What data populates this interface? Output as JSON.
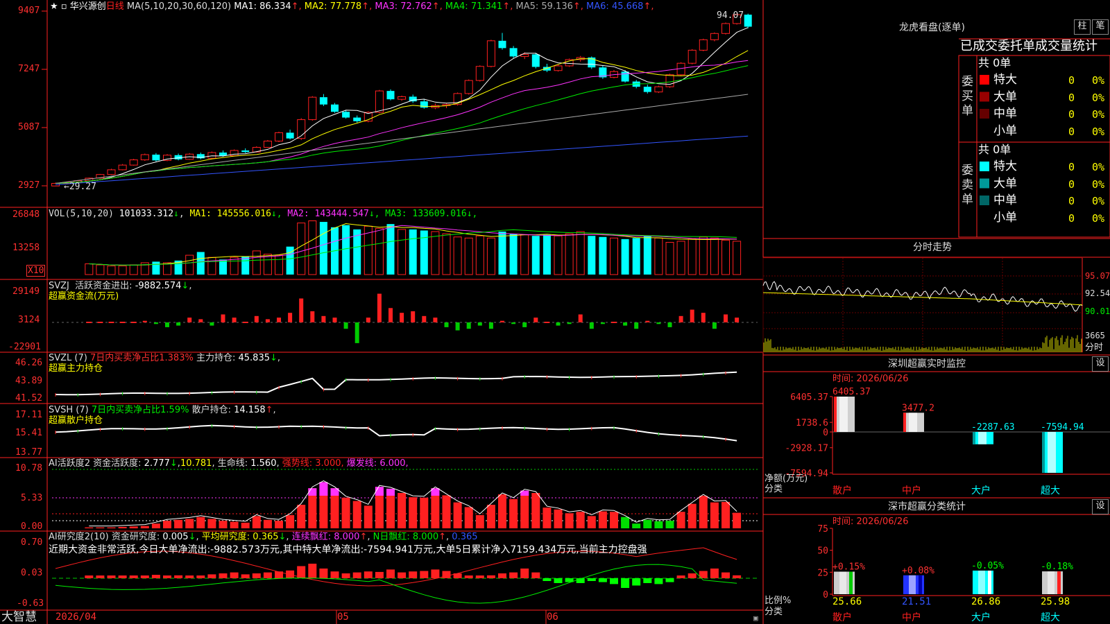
{
  "stock": {
    "name": "华兴源创",
    "period": "日线",
    "ma_label": "MA(5,10,20,30,60,120)",
    "ma": [
      {
        "name": "MA1",
        "value": "86.334",
        "color": "#ffffff"
      },
      {
        "name": "MA2",
        "value": "77.778",
        "color": "#ffff00"
      },
      {
        "name": "MA3",
        "value": "72.762",
        "color": "#ff33ff"
      },
      {
        "name": "MA4",
        "value": "71.341",
        "color": "#00ee00"
      },
      {
        "name": "MA5",
        "value": "59.136",
        "color": "#aaaaaa"
      },
      {
        "name": "MA6",
        "value": "45.668",
        "color": "#3355ff"
      }
    ],
    "up_arrow": "↑",
    "down_arrow": "↓",
    "high_label": "94.07",
    "low_label": "←29.27"
  },
  "price_axis": [
    "9407",
    "7247",
    "5087",
    "2927"
  ],
  "vol": {
    "axis": [
      "26848",
      "13258"
    ],
    "unit": "X10",
    "title": "VOL(5,10,20)",
    "value": "101033.312",
    "ma": [
      {
        "name": "MA1",
        "value": "145556.016",
        "color": "#ffff00"
      },
      {
        "name": "MA2",
        "value": "143444.547",
        "color": "#ff33ff"
      },
      {
        "name": "MA3",
        "value": "133609.016",
        "color": "#00ee00"
      }
    ],
    "values": [
      10,
      9,
      8,
      8,
      9,
      11,
      12,
      11,
      13,
      18,
      21,
      16,
      14,
      16,
      17,
      22,
      19,
      18,
      26,
      48,
      50,
      49,
      44,
      46,
      42,
      45,
      43,
      47,
      42,
      42,
      41,
      40,
      38,
      35,
      34,
      36,
      34,
      40,
      38,
      37,
      36,
      37,
      36,
      38,
      40,
      36,
      35,
      34,
      33,
      34,
      36,
      34,
      30,
      31,
      33,
      35,
      34,
      32,
      31
    ]
  },
  "svzj": {
    "axis": [
      "29149",
      "3124",
      "-22901"
    ],
    "title": "SVZJ",
    "label": "活跃资金进出:",
    "value": "-9882.574",
    "sub": "超赢资金流(万元)",
    "values": [
      0,
      0,
      0,
      0,
      0,
      0.1,
      -0.1,
      -0.3,
      -0.2,
      0.3,
      0.2,
      -0.2,
      0.5,
      0.3,
      0,
      0.4,
      0.2,
      0.3,
      0.6,
      1.5,
      0.7,
      0.4,
      0.3,
      -0.4,
      -1.3,
      0.3,
      1.8,
      0.9,
      0.6,
      0.7,
      0.4,
      0.3,
      -0.3,
      -0.5,
      -0.4,
      -0.2,
      -0.4,
      0.1,
      -0.1,
      -0.3,
      0.3,
      0,
      -0.2,
      -0.1,
      0.5,
      -0.4,
      -0.1,
      0,
      -0.2,
      -0.4,
      0.1,
      -0.1,
      -0.3,
      0.4,
      0.8,
      0.6,
      -0.4,
      0.5,
      0.3
    ]
  },
  "svzl": {
    "axis": [
      "46.26",
      "43.89",
      "41.52"
    ],
    "title": "SVZL (7)",
    "desc": "7日内买卖净占比1.383%",
    "label": "主力持仓:",
    "value": "45.835",
    "sub": "超赢主力持仓"
  },
  "svsh": {
    "axis": [
      "17.11",
      "15.41",
      "13.77"
    ],
    "title": "SVSH (7)",
    "desc": "7日内买卖净占比1.59%",
    "label": "散户持仓:",
    "value": "14.158",
    "sub": "超赢散户持仓"
  },
  "ai1": {
    "axis": [
      "10.78",
      "5.33",
      "0.00"
    ],
    "title": "AI活跃度2",
    "label": "资金活跃度:",
    "value": "2.777",
    "value2": "10.781",
    "life_label": "生命线:",
    "life": "1.560",
    "strong_label": "强势线:",
    "strong": "3.000",
    "burst_label": "爆发线:",
    "burst": "6.000",
    "values": [
      0.2,
      0.2,
      0.2,
      0.3,
      0.4,
      0.5,
      1.0,
      1.6,
      1.8,
      2.0,
      2.4,
      2.0,
      1.6,
      1.4,
      1.2,
      2.6,
      1.8,
      1.6,
      2.8,
      5.0,
      8.5,
      9.8,
      8.5,
      6.5,
      5.8,
      4.8,
      8.8,
      8.4,
      7.5,
      6.6,
      6.5,
      8.5,
      7.0,
      5.5,
      4.5,
      2.8,
      5.0,
      7.2,
      6.2,
      8.0,
      7.5,
      4.4,
      4.0,
      3.2,
      3.5,
      2.6,
      3.6,
      3.5,
      2.4,
      1.0,
      1.8,
      1.5,
      1.6,
      3.5,
      5.2,
      6.9,
      5.5,
      5.6,
      3.3
    ]
  },
  "ai2": {
    "axis": [
      "0.70",
      "0.03",
      "-0.63"
    ],
    "title": "AI研究度2(10)",
    "label": "资金研究度:",
    "value": "0.005",
    "avg_label": "平均研究度:",
    "avg": "0.365",
    "cont_label": "连续飘红:",
    "cont": "8.000",
    "nred_label": "N日飘红:",
    "nred": "8.000",
    "tail": "0.365",
    "comment": "近期大资金非常活跃,今日大单净流出:-9882.573万元,其中特大单净流出:-7594.941万元,大单5日累计净入7159.434万元,当前主力控盘强",
    "values": [
      0.03,
      0.02,
      0.05,
      0.04,
      0.03,
      0.05,
      0.07,
      0.05,
      0.06,
      0.05,
      0.04,
      0.08,
      0.1,
      0.12,
      0.08,
      0.1,
      0.12,
      0.14,
      0.16,
      0.25,
      0.3,
      0.2,
      0.14,
      0.1,
      0.12,
      0.14,
      0.13,
      0.18,
      0.12,
      0.14,
      0.15,
      0.18,
      0.15,
      0.1,
      0.05,
      0.02,
      0.06,
      0.1,
      0.12,
      0.2,
      0.12,
      -0.05,
      -0.1,
      -0.08,
      -0.1,
      -0.05,
      -0.08,
      -0.12,
      -0.2,
      -0.15,
      -0.1,
      -0.12,
      -0.08,
      0.05,
      0.1,
      0.15,
      0.2,
      0.12,
      0.06
    ]
  },
  "xaxis": {
    "labels": [
      "2026/04",
      "05",
      "06"
    ]
  },
  "footer": {
    "brand": "大智慧"
  },
  "dragon": {
    "title": "龙虎看盘(逐单)",
    "btn1": "柱",
    "btn2": "笔",
    "headers": [
      "已成交",
      "委托单",
      "成交量",
      "统计"
    ],
    "buy_side": "委买单",
    "sell_side": "委卖单",
    "buy_total": "共 0单",
    "sell_total": "共 0单",
    "buy_rows": [
      {
        "name": "特大",
        "count": "0",
        "pct": "0%",
        "color": "#ff0000"
      },
      {
        "name": "大单",
        "count": "0",
        "pct": "0%",
        "color": "#990000"
      },
      {
        "name": "中单",
        "count": "0",
        "pct": "0%",
        "color": "#660000"
      },
      {
        "name": "小单",
        "count": "0",
        "pct": "0%",
        "color": ""
      }
    ],
    "sell_rows": [
      {
        "name": "特大",
        "count": "0",
        "pct": "0%",
        "color": "#00ffff"
      },
      {
        "name": "大单",
        "count": "0",
        "pct": "0%",
        "color": "#009999"
      },
      {
        "name": "中单",
        "count": "0",
        "pct": "0%",
        "color": "#006666"
      },
      {
        "name": "小单",
        "count": "0",
        "pct": "0%",
        "color": ""
      }
    ]
  },
  "intraday": {
    "title": "分时走势",
    "axis": [
      "95.07",
      "92.54",
      "90.01"
    ],
    "vol": "3665",
    "label": "分时"
  },
  "sz_monitor": {
    "title": "深圳超赢实时监控",
    "btn": "设",
    "time_label": "时间:",
    "time": "2026/06/26",
    "axis": [
      "6405.37",
      "1738.6",
      "0",
      "-2928.17",
      "-7594.94"
    ],
    "ylabel": "净额(万元)",
    "xlabel": "分类",
    "bars": [
      {
        "name": "散户",
        "value": 6405.37,
        "label": "6405.37",
        "color": "#cccccc",
        "cat_color": "#ff2020"
      },
      {
        "name": "中户",
        "value": 3477.2,
        "label": "3477.2",
        "color": "#cccccc",
        "cat_color": "#ff2020"
      },
      {
        "name": "大户",
        "value": -2287.63,
        "label": "-2287.63",
        "color": "#00ffff",
        "cat_color": "#00ffff"
      },
      {
        "name": "超大",
        "value": -7594.94,
        "label": "-7594.94",
        "color": "#00ffff",
        "cat_color": "#00ffff"
      }
    ]
  },
  "sc_stats": {
    "title": "深市超赢分类统计",
    "btn": "设",
    "time_label": "时间:",
    "time": "2026/06/26",
    "axis": [
      "75",
      "50",
      "25",
      "0"
    ],
    "ylabel": "比例%",
    "xlabel": "分类",
    "bars": [
      {
        "name": "散户",
        "pct": 25.66,
        "pct_label": "25.66",
        "delta": "+0.15%",
        "color": "#cccccc",
        "stripe": "#00cc00",
        "delta_color": "#ff3333",
        "cat_color": "#ff2020"
      },
      {
        "name": "中户",
        "pct": 21.51,
        "pct_label": "21.51",
        "delta": "+0.08%",
        "color": "#2233ff",
        "stripe": "#0000aa",
        "delta_color": "#ff3333",
        "cat_color": "#ff2020"
      },
      {
        "name": "大户",
        "pct": 26.86,
        "pct_label": "26.86",
        "delta": "-0.05%",
        "color": "#00ffff",
        "stripe": "#ffffff",
        "delta_color": "#00ff00",
        "cat_color": "#00ffff"
      },
      {
        "name": "超大",
        "pct": 25.98,
        "pct_label": "25.98",
        "delta": "-0.18%",
        "color": "#cccccc",
        "stripe": "#ff2020",
        "delta_color": "#00ff00",
        "cat_color": "#00ffff"
      }
    ]
  },
  "candles": [
    [
      28.0,
      29.3,
      27.9,
      29.0
    ],
    [
      29.0,
      29.6,
      28.6,
      29.4
    ],
    [
      29.4,
      30.2,
      29.2,
      30.0
    ],
    [
      30.0,
      31.2,
      29.8,
      31.0
    ],
    [
      31.0,
      32.6,
      30.8,
      32.4
    ],
    [
      32.4,
      34.6,
      32.2,
      34.2
    ],
    [
      34.2,
      36.4,
      34.0,
      36.0
    ],
    [
      36.0,
      38.4,
      35.8,
      38.0
    ],
    [
      38.0,
      40.4,
      37.6,
      40.0
    ],
    [
      40.0,
      40.6,
      37.4,
      37.8
    ],
    [
      37.8,
      40.2,
      37.5,
      39.8
    ],
    [
      39.8,
      40.4,
      37.8,
      38.2
    ],
    [
      38.2,
      40.6,
      38.0,
      40.2
    ],
    [
      40.2,
      40.8,
      38.2,
      38.6
    ],
    [
      38.6,
      41.2,
      38.4,
      40.8
    ],
    [
      40.8,
      41.6,
      39.2,
      39.6
    ],
    [
      39.6,
      42.0,
      39.4,
      41.6
    ],
    [
      41.6,
      42.4,
      40.6,
      41.0
    ],
    [
      41.0,
      43.2,
      40.8,
      42.8
    ],
    [
      42.8,
      45.6,
      42.6,
      45.2
    ],
    [
      45.2,
      48.8,
      44.8,
      48.4
    ],
    [
      48.4,
      49.6,
      45.8,
      46.2
    ],
    [
      46.2,
      54.0,
      45.6,
      53.4
    ],
    [
      53.4,
      62.4,
      53.0,
      62.0
    ],
    [
      62.0,
      63.2,
      58.6,
      59.2
    ],
    [
      59.2,
      59.8,
      56.0,
      56.4
    ],
    [
      56.4,
      57.0,
      53.8,
      54.2
    ],
    [
      54.2,
      55.0,
      52.2,
      52.8
    ],
    [
      52.8,
      56.6,
      52.4,
      56.2
    ],
    [
      56.2,
      64.8,
      55.8,
      64.4
    ],
    [
      64.4,
      65.0,
      60.8,
      61.2
    ],
    [
      61.2,
      62.6,
      60.6,
      62.2
    ],
    [
      62.2,
      63.0,
      59.8,
      60.4
    ],
    [
      60.4,
      61.2,
      57.6,
      58.0
    ],
    [
      58.0,
      59.6,
      57.4,
      58.8
    ],
    [
      58.8,
      59.6,
      57.8,
      59.2
    ],
    [
      59.2,
      63.8,
      58.8,
      63.4
    ],
    [
      63.4,
      68.8,
      63.0,
      68.4
    ],
    [
      68.4,
      74.2,
      68.0,
      73.8
    ],
    [
      73.8,
      84.0,
      73.4,
      83.6
    ],
    [
      83.6,
      86.6,
      80.2,
      80.8
    ],
    [
      80.8,
      81.6,
      77.0,
      77.6
    ],
    [
      77.6,
      79.2,
      76.6,
      78.4
    ],
    [
      78.4,
      79.0,
      73.0,
      73.6
    ],
    [
      73.6,
      74.8,
      71.6,
      72.2
    ],
    [
      72.2,
      74.6,
      71.8,
      74.0
    ],
    [
      74.0,
      76.8,
      73.6,
      76.4
    ],
    [
      76.4,
      77.8,
      75.6,
      77.2
    ],
    [
      77.2,
      77.6,
      72.8,
      73.4
    ],
    [
      73.4,
      74.0,
      69.0,
      69.6
    ],
    [
      69.6,
      72.4,
      69.2,
      71.8
    ],
    [
      71.8,
      72.4,
      67.6,
      68.0
    ],
    [
      68.0,
      68.6,
      65.4,
      66.0
    ],
    [
      66.0,
      66.8,
      63.4,
      64.0
    ],
    [
      64.0,
      66.4,
      63.6,
      66.0
    ],
    [
      66.0,
      71.0,
      65.6,
      70.6
    ],
    [
      70.6,
      75.4,
      70.2,
      75.0
    ],
    [
      75.0,
      80.4,
      74.6,
      80.0
    ],
    [
      80.0,
      84.4,
      79.6,
      84.0
    ],
    [
      84.0,
      86.8,
      83.4,
      86.4
    ],
    [
      86.4,
      90.6,
      86.0,
      90.2
    ],
    [
      90.2,
      94.07,
      89.8,
      93.6
    ],
    [
      93.6,
      94.0,
      88.4,
      89.0
    ]
  ]
}
